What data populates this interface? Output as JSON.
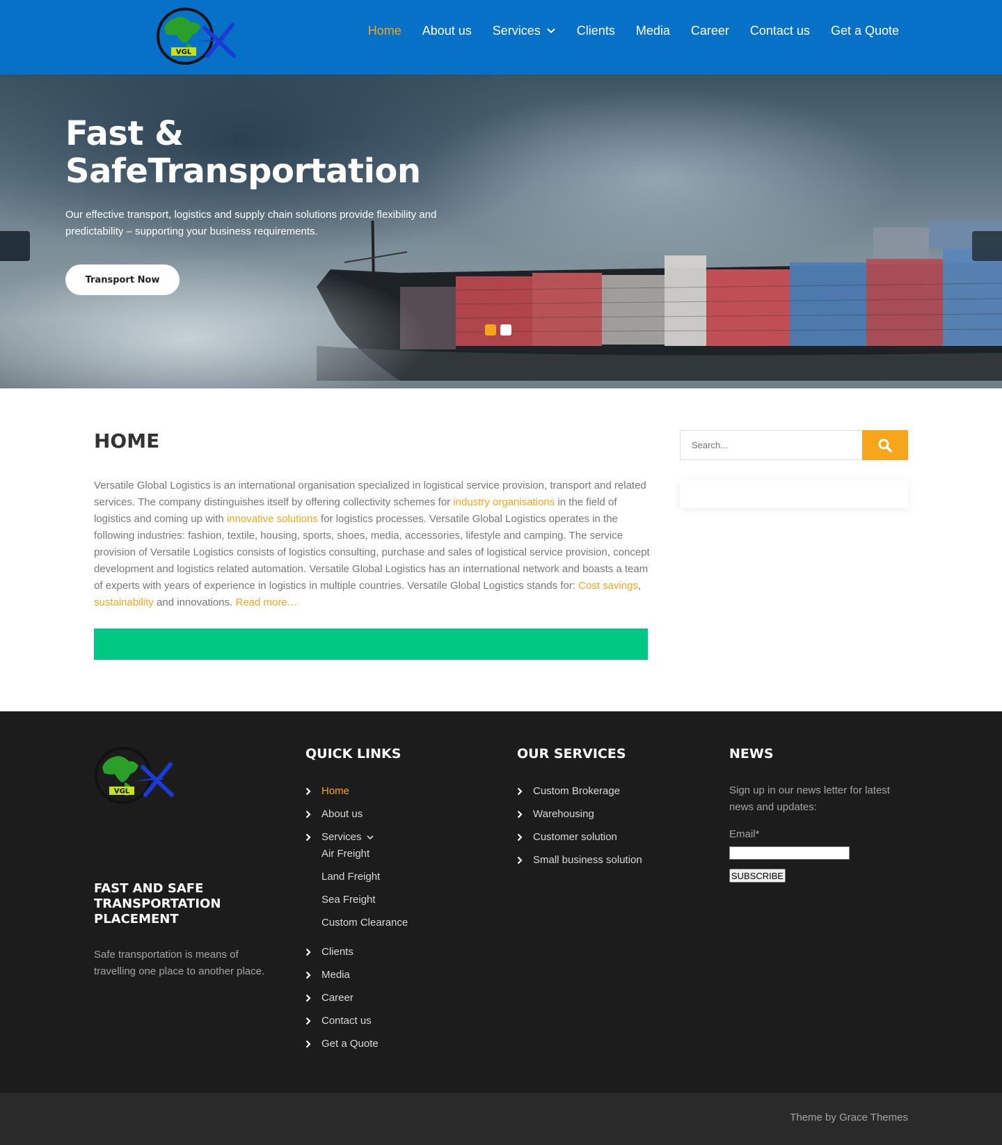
{
  "header": {
    "logo_text": "VGL",
    "nav": [
      {
        "label": "Home",
        "active": true
      },
      {
        "label": "About us"
      },
      {
        "label": "Services",
        "dropdown": true
      },
      {
        "label": "Clients"
      },
      {
        "label": "Media"
      },
      {
        "label": "Career"
      },
      {
        "label": "Contact us"
      },
      {
        "label": "Get a Quote"
      }
    ]
  },
  "hero": {
    "title_line1": "Fast &",
    "title_line2": "SafeTransportation",
    "subtitle": "Our effective transport, logistics and supply chain solutions provide flexibility and predictability – supporting your business requirements.",
    "button": "Transport Now",
    "slides_count": 2,
    "active_slide": 1
  },
  "main": {
    "title": "HOME",
    "text_1": "Versatile Global Logistics is an international organisation specialized in logistical service provision, transport and related services. The company distinguishes itself by offering collectivity schemes for ",
    "link_1": "industry organisations",
    "text_2": " in the field of logistics and coming up with ",
    "link_2": "innovative solutions",
    "text_3": " for logistics processes. Versatile Global Logistics operates in the following industries: fashion, textile, housing, sports, shoes, media, accessories, lifestyle and camping. The service provision of Versatile Logistics consists of logistics consulting, purchase and sales of logistical service provision, concept development and logistics related automation. Versatile Global Logistics has an international network and boasts a team of experts with years of experience in logistics in multiple countries. Versatile Global Logistics stands for: ",
    "link_3": "Cost savings",
    "sep": ", ",
    "link_4": "sustainability",
    "text_4": " and innovations. ",
    "read_more": "Read more…"
  },
  "sidebar": {
    "search_placeholder": "Search..."
  },
  "footer": {
    "logo_text": "VGL",
    "tagline": "FAST AND SAFE TRANSPORTATION PLACEMENT",
    "tagline_text": "Safe transportation is means of travelling one place to another place.",
    "quick_links_title": "QUICK LINKS",
    "quick_links": [
      "Home",
      "About us",
      "Services"
    ],
    "services_sub": [
      "Air Freight",
      "Land Freight",
      "Sea Freight",
      "Custom Clearance"
    ],
    "quick_links_2": [
      "Clients",
      "Media",
      "Career",
      "Contact us",
      "Get a Quote"
    ],
    "services_title": "OUR SERVICES",
    "services": [
      "Custom Brokerage",
      "Warehousing",
      "Customer solution",
      "Small business solution"
    ],
    "news_title": "NEWS",
    "news_text": "Sign up in our news letter for latest news and updates:",
    "email_label": "Email*",
    "subscribe": "SUBSCRIBE",
    "credit_prefix": "Theme by ",
    "credit_link": "Grace Themes"
  },
  "colors": {
    "header_bg": "#0671c7",
    "accent": "#f7a51b",
    "green_bar": "#00c781",
    "footer_bg": "#1c1c1c"
  }
}
